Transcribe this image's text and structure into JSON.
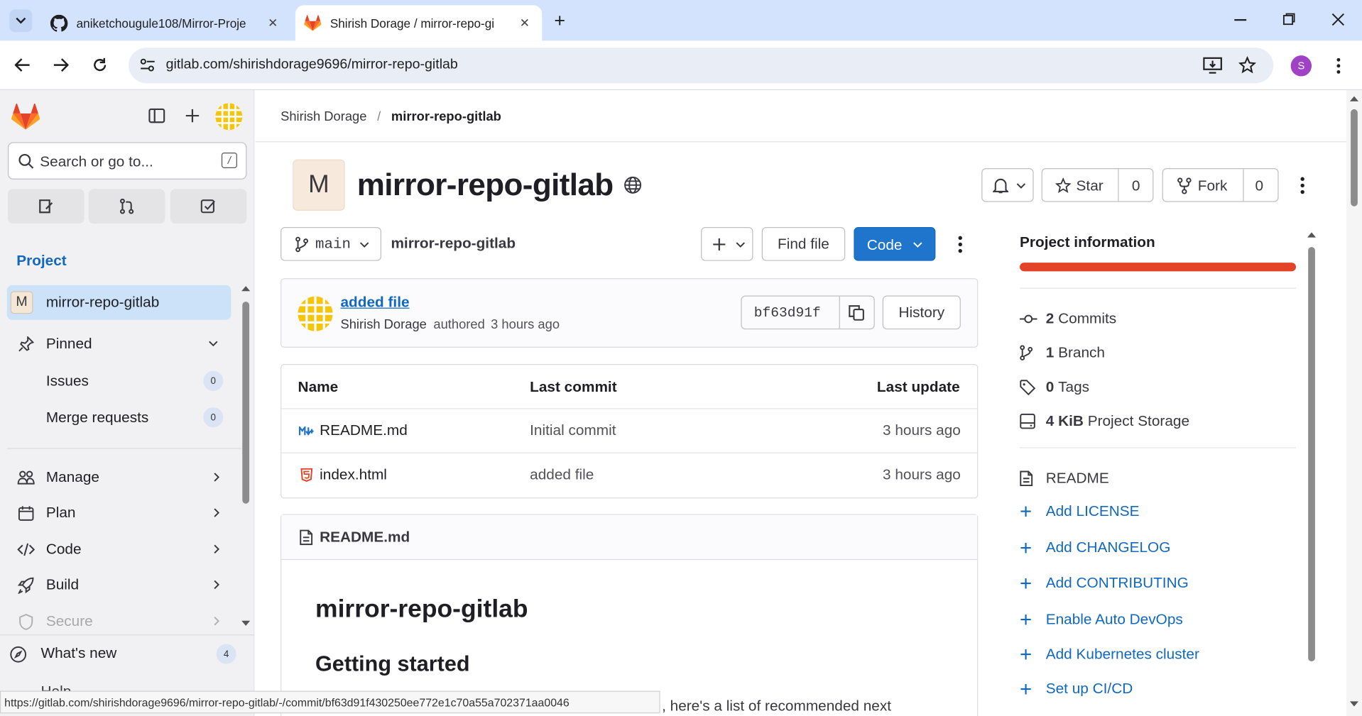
{
  "browser": {
    "tabs": [
      {
        "title": "aniketchougule108/Mirror-Proje",
        "icon": "github-icon"
      },
      {
        "title": "Shirish Dorage / mirror-repo-gi",
        "icon": "gitlab-icon"
      }
    ],
    "url": "gitlab.com/shirishdorage9696/mirror-repo-gitlab",
    "profile_initial": "S",
    "status_url": "https://gitlab.com/shirishdorage9696/mirror-repo-gitlab/-/commit/bf63d91f430250ee772e1c70a55a702371aa0046"
  },
  "sidebar": {
    "search_placeholder": "Search or go to...",
    "search_shortcut": "/",
    "section_label": "Project",
    "project": {
      "avatar": "M",
      "name": "mirror-repo-gitlab"
    },
    "pinned": {
      "label": "Pinned",
      "items": [
        {
          "label": "Issues",
          "count": "0"
        },
        {
          "label": "Merge requests",
          "count": "0"
        }
      ]
    },
    "nav": [
      {
        "label": "Manage",
        "icon": "users-icon"
      },
      {
        "label": "Plan",
        "icon": "calendar-icon"
      },
      {
        "label": "Code",
        "icon": "code-icon"
      },
      {
        "label": "Build",
        "icon": "rocket-icon"
      },
      {
        "label": "Secure",
        "icon": "shield-icon"
      }
    ],
    "whats_new": {
      "label": "What's new",
      "count": "4"
    },
    "help_label": "Help"
  },
  "breadcrumb": {
    "owner": "Shirish Dorage",
    "separator": "/",
    "project": "mirror-repo-gitlab"
  },
  "project": {
    "avatar": "M",
    "title": "mirror-repo-gitlab",
    "star_label": "Star",
    "star_count": "0",
    "fork_label": "Fork",
    "fork_count": "0"
  },
  "repo": {
    "branch": "main",
    "path": "mirror-repo-gitlab",
    "find_file": "Find file",
    "code_button": "Code",
    "commit": {
      "message": "added file",
      "author": "Shirish Dorage",
      "authored_text": "authored",
      "time": "3 hours ago",
      "sha": "bf63d91f",
      "history_label": "History"
    },
    "table": {
      "headers": [
        "Name",
        "Last commit",
        "Last update"
      ],
      "rows": [
        {
          "name": "README.md",
          "icon": "markdown-icon",
          "commit": "Initial commit",
          "updated": "3 hours ago"
        },
        {
          "name": "index.html",
          "icon": "html5-icon",
          "commit": "added file",
          "updated": "3 hours ago"
        }
      ]
    },
    "readme": {
      "file_label": "README.md",
      "h1": "mirror-repo-gitlab",
      "h2": "Getting started",
      "text_fragment": ", here's a list of recommended next"
    }
  },
  "project_info": {
    "title": "Project information",
    "bar_color": "#e24329",
    "stats": [
      {
        "value": "2",
        "label": "Commits",
        "icon": "commit-icon"
      },
      {
        "value": "1",
        "label": "Branch",
        "icon": "branch-icon"
      },
      {
        "value": "0",
        "label": "Tags",
        "icon": "tag-icon"
      },
      {
        "value": "4 KiB",
        "label": "Project Storage",
        "icon": "storage-icon"
      }
    ],
    "readme_label": "README",
    "links": [
      "Add LICENSE",
      "Add CHANGELOG",
      "Add CONTRIBUTING",
      "Enable Auto DevOps",
      "Add Kubernetes cluster",
      "Set up CI/CD"
    ]
  },
  "colors": {
    "accent": "#1f75cb",
    "link": "#1068bf",
    "brand": "#e24329",
    "sidebar_bg": "#f1f1f3"
  }
}
